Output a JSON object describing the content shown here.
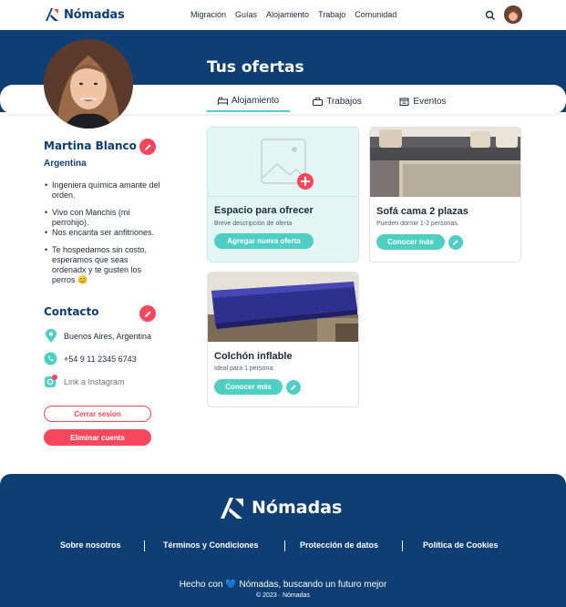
{
  "brand": {
    "name": "Nómadas"
  },
  "nav": {
    "links": [
      "Migración",
      "Guías",
      "Alojamiento",
      "Trabajo",
      "Comunidad"
    ]
  },
  "page": {
    "title": "Tus ofertas",
    "tabs": [
      {
        "label": "Alojamiento",
        "icon": "bed-icon",
        "active": true
      },
      {
        "label": "Trabajos",
        "icon": "briefcase-icon",
        "active": false
      },
      {
        "label": "Eventos",
        "icon": "calendar-icon",
        "active": false
      }
    ]
  },
  "profile": {
    "name": "Martina Blanco",
    "country": "Argentina",
    "bio": [
      "Ingeniera química amante del orden.",
      "Vivo con Manchis (mi perrohijo).",
      "Nos encanta ser anfitriones.",
      "Te hospedamos sin costo, esperamos que seas ordenadx y te gusten los perros 😊"
    ],
    "contact_title": "Contacto",
    "location": "Buenos Aires, Argentina",
    "phone": "+54 9 11 2345 6743",
    "instagram": "Link a Instagram",
    "logout_label": "Cerrar sesion",
    "delete_label": "Eliminar cuenta"
  },
  "cards": {
    "add": {
      "title": "Espacio para ofrecer",
      "subtitle": "Breve descripción de oferta",
      "button": "Agregar nueva oferta"
    },
    "offers": [
      {
        "title": "Sofá cama 2 plazas",
        "subtitle": "Pueden dormir 1-2 personas.",
        "button": "Conocer más"
      },
      {
        "title": "Colchón inflable",
        "subtitle": "Ideal para 1 persona.",
        "button": "Conocer más"
      }
    ]
  },
  "footer": {
    "links": [
      "Sobre nosotros",
      "Términos y Condiciones",
      "Protección de datos",
      "Política de Cookies"
    ],
    "tagline": "Hecho con 💙 Nómadas, buscando un futuro mejor",
    "copyright": "© 2023 · Nómadas"
  },
  "colors": {
    "primary": "#0e3e73",
    "accent": "#4fcfc4",
    "danger": "#f6475d"
  }
}
